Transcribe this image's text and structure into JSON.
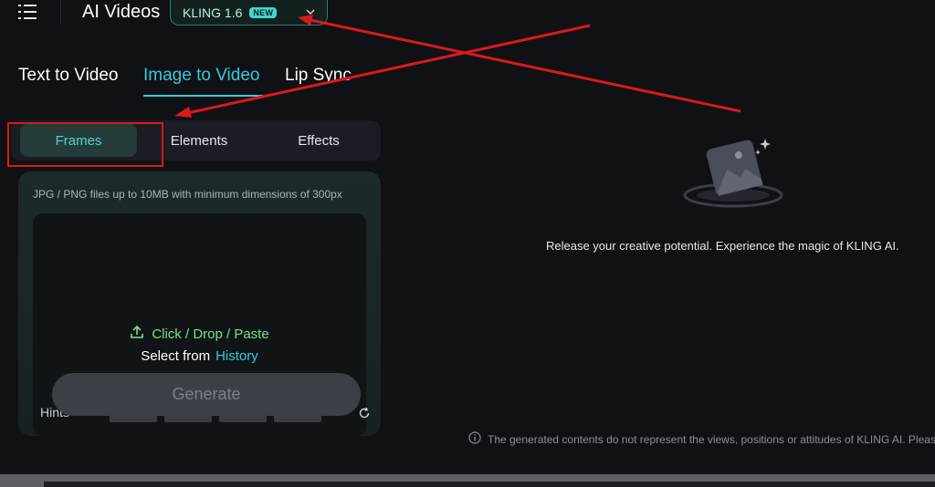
{
  "header": {
    "title": "AI Videos",
    "model": {
      "name": "KLING 1.6",
      "badge": "NEW"
    }
  },
  "mode_tabs": [
    {
      "label": "Text to Video",
      "active": false
    },
    {
      "label": "Image to Video",
      "active": true
    },
    {
      "label": "Lip Sync",
      "active": false
    }
  ],
  "sub_tabs": [
    {
      "label": "Frames",
      "active": true
    },
    {
      "label": "Elements",
      "active": false
    },
    {
      "label": "Effects",
      "active": false
    }
  ],
  "upload": {
    "hint": "JPG / PNG files up to 10MB with minimum dimensions of 300px",
    "primary": "Click / Drop / Paste",
    "select_from": "Select from",
    "history": "History",
    "hints_label": "Hints"
  },
  "generate_label": "Generate",
  "empty_state": "Release your creative potential. Experience the magic of KLING AI.",
  "disclaimer": "The generated contents do not represent the views, positions or attitudes of KLING AI. Please",
  "colors": {
    "accent": "#38c9dc",
    "frames_active": "#4fd5c9",
    "upload_green": "#77e08d",
    "annotation_red": "#d9191b"
  }
}
